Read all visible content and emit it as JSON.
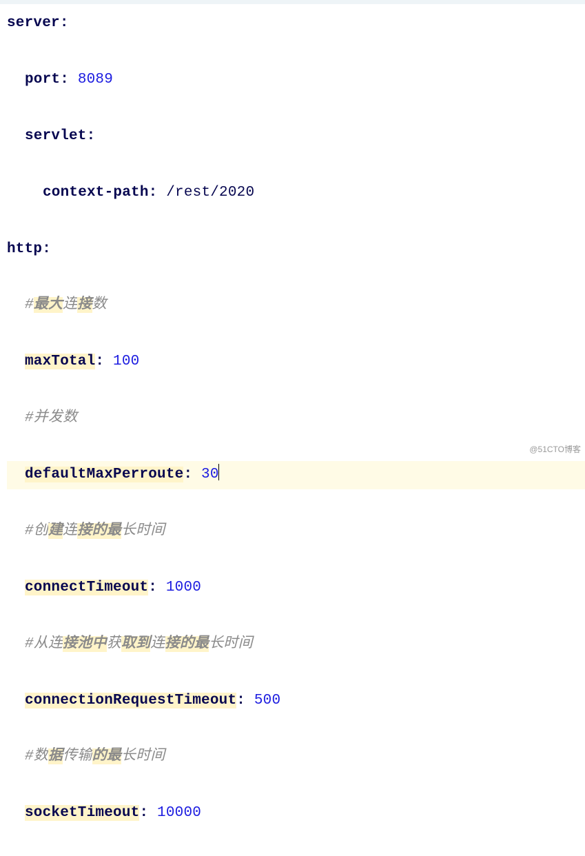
{
  "code": {
    "server_key": "server",
    "port_key": "port",
    "port_value": "8089",
    "servlet_key": "servlet",
    "context_path_key": "context-path",
    "context_path_value": "/rest/2020",
    "http_key": "http",
    "comment_max_total": "#最大连接数",
    "max_total_key": "maxTotal",
    "max_total_value": "100",
    "comment_concurrent": "#并发数",
    "default_max_perroute_key": "defaultMaxPerroute",
    "default_max_perroute_value": "30",
    "comment_connect_timeout": "#创建连接的最长时间",
    "connect_timeout_key": "connectTimeout",
    "connect_timeout_value": "1000",
    "comment_conn_req_timeout": "#从连接池中获取到连接的最长时间",
    "conn_req_timeout_key": "connectionRequestTimeout",
    "conn_req_timeout_value": "500",
    "comment_socket_timeout": "#数据传输的最长时间",
    "socket_timeout_key": "socketTimeout",
    "socket_timeout_value": "10000"
  },
  "watermark": "@51CTO博客"
}
